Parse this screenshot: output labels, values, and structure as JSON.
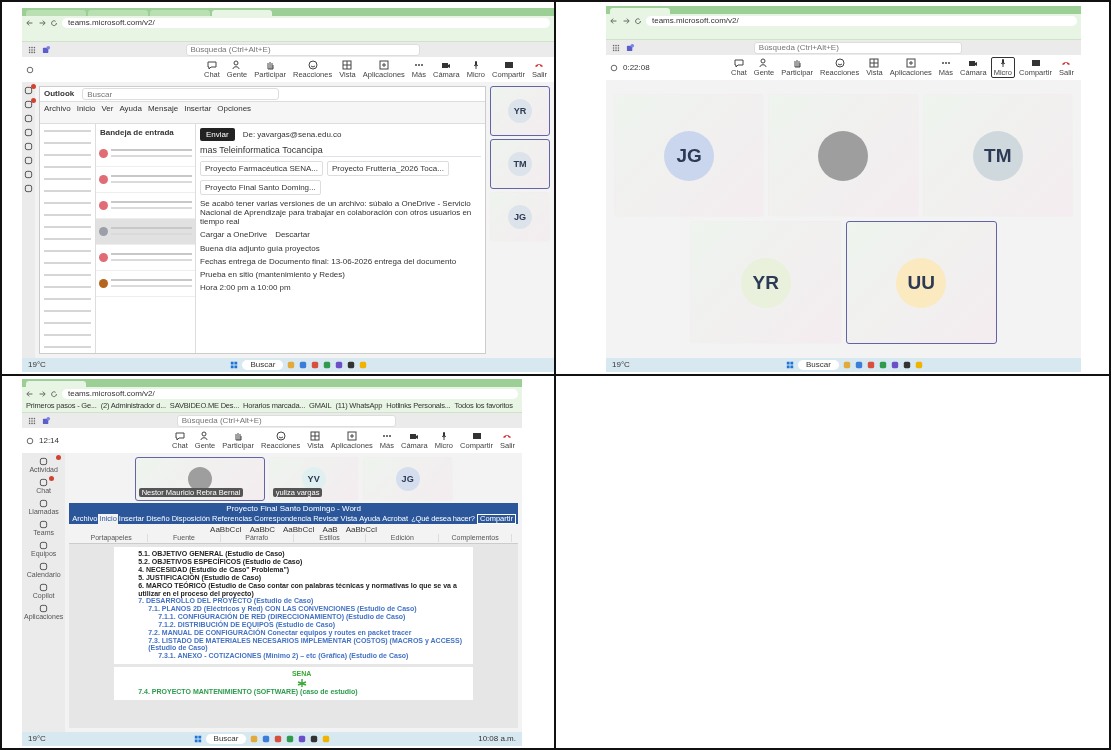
{
  "screenshots": [
    {
      "kind": "outlook_share",
      "browser": {
        "tabs": [
          {
            "selected": false
          },
          {
            "selected": false
          },
          {
            "selected": false
          },
          {
            "selected": true
          }
        ],
        "url": "teams.microsoft.com/v2/"
      },
      "teams": {
        "search_placeholder": "Búsqueda (Ctrl+Alt+E)",
        "rail": [
          {
            "badge": true
          },
          {
            "badge": true
          },
          {
            "badge": false
          },
          {
            "badge": false
          },
          {
            "badge": false
          },
          {
            "badge": false
          },
          {
            "badge": false
          },
          {
            "badge": false
          }
        ],
        "toolbar": [
          {
            "kind": "chat",
            "label": "Chat",
            "selected": false
          },
          {
            "kind": "people",
            "label": "Gente",
            "selected": false
          },
          {
            "kind": "hand",
            "label": "Participar",
            "selected": false
          },
          {
            "kind": "smile",
            "label": "Reacciones",
            "selected": false
          },
          {
            "kind": "grid",
            "label": "Vista",
            "selected": false
          },
          {
            "kind": "apps",
            "label": "Aplicaciones",
            "selected": false
          },
          {
            "kind": "more",
            "label": "Más",
            "selected": false
          },
          {
            "kind": "camera",
            "label": "Cámara",
            "selected": false
          },
          {
            "kind": "mic",
            "label": "Micro",
            "selected": false
          },
          {
            "kind": "share",
            "label": "Compartir",
            "selected": false
          },
          {
            "kind": "leave",
            "label": "Salir",
            "selected": false
          }
        ]
      },
      "outlook": {
        "app": "Outlook",
        "search_placeholder": "Buscar",
        "ribbon_tabs": [
          "Archivo",
          "Inicio",
          "Ver",
          "Ayuda",
          "Mensaje",
          "Insertar",
          "Opciones"
        ],
        "list_title": "Bandeja de entrada",
        "messages": [
          {
            "selected": false,
            "color": "#e06c75"
          },
          {
            "selected": false,
            "color": "#e06c75"
          },
          {
            "selected": false,
            "color": "#e06c75"
          },
          {
            "selected": true,
            "color": "#9aa0a6"
          },
          {
            "selected": false,
            "color": "#e06c75"
          },
          {
            "selected": false,
            "color": "#b5651d"
          }
        ],
        "send_label": "Enviar",
        "from": "De: yavargas@sena.edu.co",
        "subject": "mas Teleinformatica Tocancipa",
        "attachments": [
          "Proyecto Farmacéutica SENA...",
          "Proyecto Fruttería_2026 Toca...",
          "Proyecto Final Santo Doming..."
        ],
        "notice": "Se acabó tener varias versiones de un archivo: súbalo a OneDrive - Servicio Nacional de Aprendizaje para trabajar en colaboración con otros usuarios en tiempo real",
        "notice_actions": [
          "Cargar a OneDrive",
          "Descartar"
        ],
        "body": [
          "Buena día adjunto guía proyectos",
          "Fechas entrega de Documento final: 13-06-2026   entrega del documento",
          "Prueba en sitio (mantenimiento y Redes)",
          "Hora    2:00 pm   a 10:00 pm"
        ]
      },
      "participants": [
        {
          "initials": "YR",
          "photo": false,
          "speaking": true
        },
        {
          "initials": "TM",
          "photo": false,
          "speaking": true
        },
        {
          "initials": "JG",
          "photo": false,
          "speaking": false
        }
      ],
      "taskbar": {
        "search": "Buscar",
        "temperature": "19°C"
      }
    },
    {
      "kind": "gallery",
      "browser": {
        "tabs": [
          {
            "selected": true
          }
        ],
        "url": "teams.microsoft.com/v2/"
      },
      "teams": {
        "search_placeholder": "Búsqueda (Ctrl+Alt+E)",
        "timer": "0:22:08",
        "toolbar": [
          {
            "kind": "chat",
            "label": "Chat",
            "selected": false
          },
          {
            "kind": "people",
            "label": "Gente",
            "selected": false
          },
          {
            "kind": "hand",
            "label": "Participar",
            "selected": false
          },
          {
            "kind": "smile",
            "label": "Reacciones",
            "selected": false
          },
          {
            "kind": "grid",
            "label": "Vista",
            "selected": false
          },
          {
            "kind": "apps",
            "label": "Aplicaciones",
            "selected": false
          },
          {
            "kind": "more",
            "label": "Más",
            "selected": false
          },
          {
            "kind": "camera",
            "label": "Cámara",
            "selected": false
          },
          {
            "kind": "mic",
            "label": "Micro",
            "selected": true
          },
          {
            "kind": "share",
            "label": "Compartir",
            "selected": false
          },
          {
            "kind": "leave",
            "label": "Salir",
            "selected": false
          }
        ]
      },
      "participants": [
        {
          "initials": "JG",
          "photo": false,
          "speaking": false,
          "color": "#c9d6ee"
        },
        {
          "photo": true,
          "speaking": false
        },
        {
          "initials": "TM",
          "photo": false,
          "speaking": false,
          "color": "#cfd8dc"
        },
        {
          "initials": "YR",
          "photo": false,
          "speaking": false,
          "color": "#e9f0dc"
        },
        {
          "initials": "UU",
          "photo": false,
          "speaking": true,
          "color": "#fbe9bf"
        }
      ],
      "taskbar": {
        "search": "Buscar",
        "temperature": "19°C"
      }
    },
    {
      "kind": "word_share",
      "browser": {
        "tabs": [
          {
            "selected": true
          }
        ],
        "url": "teams.microsoft.com/v2/",
        "bookmarks": [
          "Primeros pasos - Ge...",
          "(2) Administrador d...",
          "SAVBIDEO.ME Des...",
          "Horarios marcada...",
          "GMAIL",
          "(11) WhatsApp",
          "Hotlinks Personals...",
          "Todos los favoritos"
        ]
      },
      "teams": {
        "search_placeholder": "Búsqueda (Ctrl+Alt+E)",
        "timer": "12:14",
        "rail": [
          {
            "label": "Actividad",
            "badge": true
          },
          {
            "label": "Chat",
            "badge": true
          },
          {
            "label": "Llamadas",
            "badge": false
          },
          {
            "label": "Teams",
            "badge": false
          },
          {
            "label": "Equipos",
            "badge": false
          },
          {
            "label": "Calendario",
            "badge": false
          },
          {
            "label": "Copilot",
            "badge": false
          },
          {
            "label": "Aplicaciones",
            "badge": false
          }
        ],
        "toolbar": [
          {
            "kind": "chat",
            "label": "Chat",
            "selected": false
          },
          {
            "kind": "people",
            "label": "Gente",
            "selected": false
          },
          {
            "kind": "hand",
            "label": "Participar",
            "selected": false
          },
          {
            "kind": "smile",
            "label": "Reacciones",
            "selected": false
          },
          {
            "kind": "grid",
            "label": "Vista",
            "selected": false
          },
          {
            "kind": "apps",
            "label": "Aplicaciones",
            "selected": false
          },
          {
            "kind": "more",
            "label": "Más",
            "selected": false
          },
          {
            "kind": "camera",
            "label": "Cámara",
            "selected": false
          },
          {
            "kind": "mic",
            "label": "Micro",
            "selected": false
          },
          {
            "kind": "share",
            "label": "Compartir",
            "selected": false
          },
          {
            "kind": "leave",
            "label": "Salir",
            "selected": false
          }
        ]
      },
      "participants": [
        {
          "photo": true,
          "speaking": true,
          "name": "Nestor Mauricio Rebra Bernal"
        },
        {
          "initials": "YV",
          "photo": false,
          "speaking": false,
          "name": "yuliza vargas",
          "color": "#e0f0f0"
        },
        {
          "initials": "JG",
          "photo": false,
          "speaking": false,
          "color": "#d5deee"
        }
      ],
      "word": {
        "title": "Proyecto Final Santo Domingo - Word",
        "tabs": [
          {
            "label": "Archivo",
            "selected": false
          },
          {
            "label": "Inicio",
            "selected": true
          },
          {
            "label": "Insertar",
            "selected": false
          },
          {
            "label": "Diseño",
            "selected": false
          },
          {
            "label": "Disposición",
            "selected": false
          },
          {
            "label": "Referencias",
            "selected": false
          },
          {
            "label": "Correspondencia",
            "selected": false
          },
          {
            "label": "Revisar",
            "selected": false
          },
          {
            "label": "Vista",
            "selected": false
          },
          {
            "label": "Ayuda",
            "selected": false
          },
          {
            "label": "Acrobat",
            "selected": false
          }
        ],
        "tell_me": "¿Qué desea hacer?",
        "share": "Compartir",
        "styles": [
          "AaBbCcI",
          "AaBbC",
          "AaBbCcI",
          "AaB",
          "AaBbCcI"
        ],
        "groups": [
          "Portapapeles",
          "Fuente",
          "Párrafo",
          "Estilos",
          "Edición",
          "Complementos"
        ],
        "lines": [
          {
            "text": "5.1. OBJETIVO GENERAL (Estudio de Caso)",
            "kind": "plain"
          },
          {
            "text": "5.2. OBJETIVOS ESPECÍFICOS (Estudio de Caso)",
            "kind": "plain"
          },
          {
            "text": "4.   NECESIDAD (Estudio de Caso\" Problema\")",
            "kind": "plain"
          },
          {
            "text": "5.   JUSTIFICACIÓN (Estudio de Caso)",
            "kind": "plain"
          },
          {
            "text": "6.   MARCO TEÓRICO (Estudio de Caso contar con palabras técnicas y normativas lo que se va a utilizar en el proceso del proyecto)",
            "kind": "plain"
          },
          {
            "text": "7.   DESARROLLO DEL PROYECTO (Estudio de Caso)",
            "kind": "heading",
            "children": [
              {
                "text": "7.1. PLANOS 2D (Eléctricos y Red) CON LAS CONVENCIONES (Estudio de Caso)",
                "kind": "heading",
                "children": [
                  {
                    "text": "7.1.1.   CONFIGURACIÓN DE RED (DIRECCIONAMIENTO) (Estudio de Caso)",
                    "kind": "heading"
                  },
                  {
                    "text": "7.1.2.   DISTRIBUCIÓN DE EQUIPOS (Estudio de Caso)",
                    "kind": "heading"
                  }
                ]
              },
              {
                "text": "7.2. MANUAL DE CONFIGURACIÓN   Conectar equipos y routes en packet tracer",
                "kind": "heading"
              },
              {
                "text": "7.3. LISTADO DE MATERIALES NECESARIOS IMPLEMENTAR (COSTOS) (MACROS y ACCESS) (Estudio de Caso)",
                "kind": "heading",
                "children": [
                  {
                    "text": "7.3.1.   ANEXO - COTIZACIONES (Mínimo 2) – etc (Gráfica) (Estudio de Caso)",
                    "kind": "heading"
                  }
                ]
              }
            ]
          }
        ],
        "logo": "SENA",
        "next_line": {
          "text": "7.4. PROYECTO MANTENIMIENTO (SOFTWARE) (caso de estudio)",
          "kind": "green"
        }
      },
      "taskbar": {
        "search": "Buscar",
        "temperature": "19°C",
        "time": "10:08 a.m."
      }
    }
  ]
}
